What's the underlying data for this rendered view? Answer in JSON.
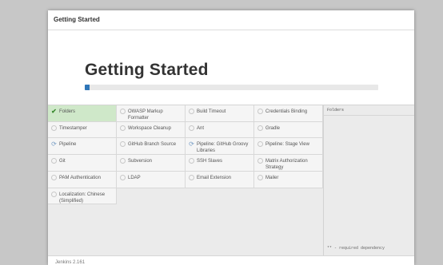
{
  "dialog": {
    "header": "Getting Started"
  },
  "hero": {
    "title": "Getting Started",
    "progress": 0.015
  },
  "plugins": [
    {
      "label": "Folders",
      "status": "done"
    },
    {
      "label": "OWASP Markup Formatter",
      "status": "pending"
    },
    {
      "label": "Build Timeout",
      "status": "pending"
    },
    {
      "label": "Credentials Binding",
      "status": "pending"
    },
    {
      "label": "Timestamper",
      "status": "pending"
    },
    {
      "label": "Workspace Cleanup",
      "status": "pending"
    },
    {
      "label": "Ant",
      "status": "pending"
    },
    {
      "label": "Gradle",
      "status": "pending"
    },
    {
      "label": "Pipeline",
      "status": "installing"
    },
    {
      "label": "GitHub Branch Source",
      "status": "pending"
    },
    {
      "label": "Pipeline: GitHub Groovy Libraries",
      "status": "installing"
    },
    {
      "label": "Pipeline: Stage View",
      "status": "pending"
    },
    {
      "label": "Git",
      "status": "pending"
    },
    {
      "label": "Subversion",
      "status": "pending"
    },
    {
      "label": "SSH Slaves",
      "status": "pending"
    },
    {
      "label": "Matrix Authorization Strategy",
      "status": "pending"
    },
    {
      "label": "PAM Authentication",
      "status": "pending"
    },
    {
      "label": "LDAP",
      "status": "pending"
    },
    {
      "label": "Email Extension",
      "status": "pending"
    },
    {
      "label": "Mailer",
      "status": "pending"
    },
    {
      "label": "Localization: Chinese (Simplified)",
      "status": "pending"
    }
  ],
  "log": {
    "title": "Folders",
    "footer": "** - required dependency"
  },
  "footer": {
    "version": "Jenkins 2.161"
  },
  "colors": {
    "accent": "#2f76b8",
    "done_bg": "#cfe8c9",
    "done_check": "#3a8a2f"
  }
}
